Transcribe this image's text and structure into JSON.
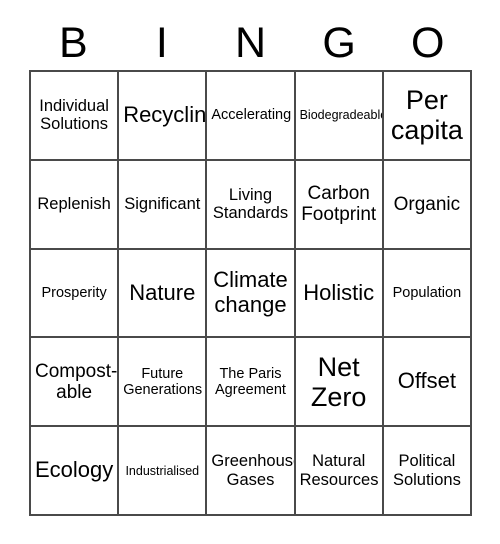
{
  "card": {
    "title_letters": [
      "B",
      "I",
      "N",
      "G",
      "O"
    ],
    "grid": {
      "columns": 5,
      "rows": 5,
      "border_color": "#4a4a4a",
      "background_color": "#ffffff",
      "text_color": "#000000"
    },
    "cells": [
      {
        "text": "Individual Solutions",
        "size": "md"
      },
      {
        "text": "Recycling",
        "size": "xl"
      },
      {
        "text": "Accelerating",
        "size": "sm"
      },
      {
        "text": "Biodegradeable",
        "size": "xs"
      },
      {
        "text": "Per capita",
        "size": "xxl"
      },
      {
        "text": "Replenish",
        "size": "md"
      },
      {
        "text": "Significant",
        "size": "md"
      },
      {
        "text": "Living Standards",
        "size": "md"
      },
      {
        "text": "Carbon Footprint",
        "size": "lg"
      },
      {
        "text": "Organic",
        "size": "lg"
      },
      {
        "text": "Prosperity",
        "size": "sm"
      },
      {
        "text": "Nature",
        "size": "xl"
      },
      {
        "text": "Climate change",
        "size": "xl"
      },
      {
        "text": "Holistic",
        "size": "xl"
      },
      {
        "text": "Population",
        "size": "sm"
      },
      {
        "text": "Compost-able",
        "size": "lg"
      },
      {
        "text": "Future Generations",
        "size": "sm"
      },
      {
        "text": "The Paris Agreement",
        "size": "sm"
      },
      {
        "text": "Net Zero",
        "size": "xxl"
      },
      {
        "text": "Offset",
        "size": "xl"
      },
      {
        "text": "Ecology",
        "size": "xl"
      },
      {
        "text": "Industrialised",
        "size": "xs"
      },
      {
        "text": "Greenhouse Gases",
        "size": "md"
      },
      {
        "text": "Natural Resources",
        "size": "md"
      },
      {
        "text": "Political Solutions",
        "size": "md"
      }
    ]
  }
}
